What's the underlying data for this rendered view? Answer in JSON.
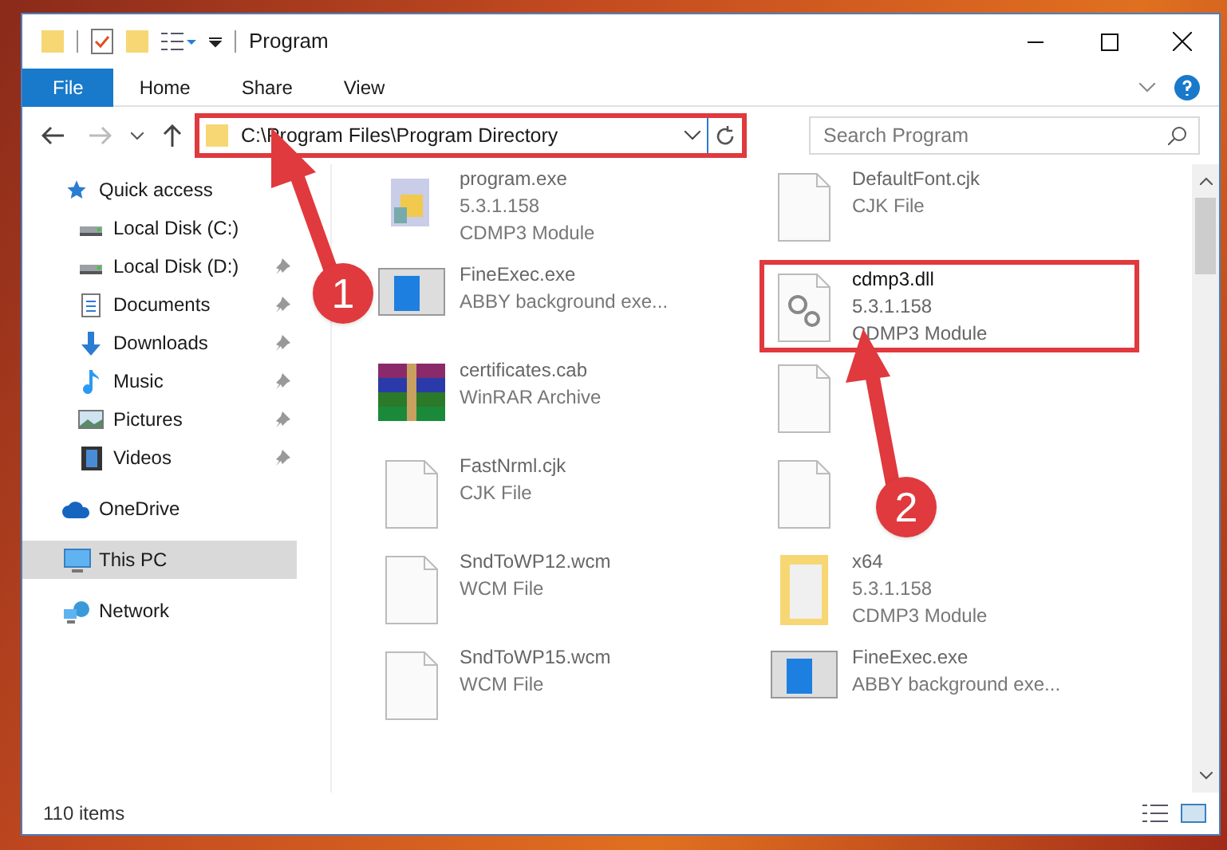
{
  "window": {
    "title": "Program"
  },
  "ribbon": {
    "tabs": [
      {
        "label": "File",
        "selected": true
      },
      {
        "label": "Home",
        "selected": false
      },
      {
        "label": "Share",
        "selected": false
      },
      {
        "label": "View",
        "selected": false
      }
    ]
  },
  "address_bar": {
    "path": "C:\\Program Files\\Program Directory",
    "highlighted": true
  },
  "search": {
    "placeholder": "Search Program"
  },
  "sidebar": {
    "items": [
      {
        "label": "Quick access",
        "kind": "star",
        "selected": false,
        "children": [
          {
            "label": "Local Disk (C:)",
            "kind": "disk",
            "pinned": false,
            "selected": false
          },
          {
            "label": "Local Disk (D:)",
            "kind": "disk",
            "pinned": true,
            "selected": false
          },
          {
            "label": "Documents",
            "kind": "document",
            "pinned": true,
            "selected": false
          },
          {
            "label": "Downloads",
            "kind": "download",
            "pinned": true,
            "selected": false
          },
          {
            "label": "Music",
            "kind": "music",
            "pinned": true,
            "selected": false
          },
          {
            "label": "Pictures",
            "kind": "picture",
            "pinned": true,
            "selected": false
          },
          {
            "label": "Videos",
            "kind": "video",
            "pinned": true,
            "selected": false
          }
        ]
      },
      {
        "label": "OneDrive",
        "kind": "cloud",
        "selected": false
      },
      {
        "label": "This PC",
        "kind": "pc",
        "selected": true
      },
      {
        "label": "Network",
        "kind": "network",
        "selected": false
      }
    ]
  },
  "files": [
    {
      "kind": "app",
      "lines": [
        "program.exe",
        "5.3.1.158",
        "CDMP3 Module"
      ],
      "highlighted": false
    },
    {
      "kind": "file",
      "lines": [
        "DefaultFont.cjk",
        "CJK File"
      ],
      "highlighted": false
    },
    {
      "kind": "window",
      "lines": [
        "FineExec.exe",
        "ABBY background exe..."
      ],
      "highlighted": false
    },
    {
      "kind": "gears",
      "lines": [
        "cdmp3.dll",
        "5.3.1.158",
        "CDMP3 Module"
      ],
      "highlighted": true
    },
    {
      "kind": "archive",
      "lines": [
        "certificates.cab",
        "WinRAR Archive"
      ],
      "highlighted": false
    },
    {
      "kind": "file",
      "highlighted": false
    },
    {
      "kind": "file",
      "lines": [
        "FastNrml.cjk",
        "CJK File"
      ],
      "highlighted": false
    },
    {
      "kind": "file",
      "highlighted": false
    },
    {
      "kind": "file",
      "lines": [
        "SndToWP12.wcm",
        "WCM File"
      ],
      "highlighted": false
    },
    {
      "kind": "folder",
      "lines": [
        "x64",
        "5.3.1.158",
        "CDMP3 Module"
      ],
      "highlighted": false
    },
    {
      "kind": "file",
      "lines": [
        "SndToWP15.wcm",
        "WCM File"
      ],
      "highlighted": false
    },
    {
      "kind": "window",
      "lines": [
        "FineExec.exe",
        "ABBY background exe..."
      ],
      "highlighted": false
    }
  ],
  "status_bar": {
    "text": "110 items"
  },
  "annotations": [
    {
      "label": "1"
    },
    {
      "label": "2"
    }
  ]
}
